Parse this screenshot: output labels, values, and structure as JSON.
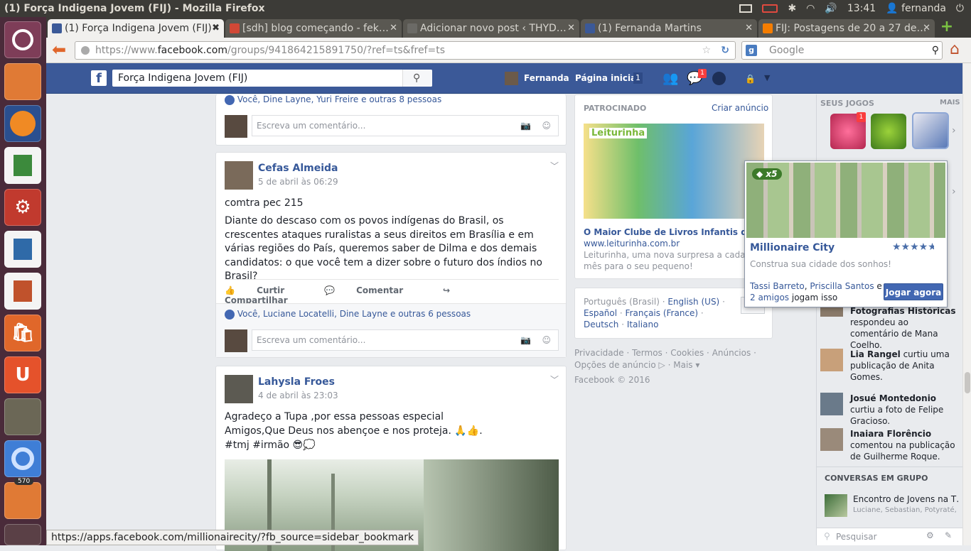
{
  "window": {
    "title": "(1) Força Indigena Jovem (FIJ) - Mozilla Firefox",
    "time": "13:41",
    "user": "fernanda"
  },
  "launcher": {
    "badge": "570",
    "apps": [
      "ubuntu-logo-icon",
      "files-icon",
      "firefox-icon",
      "spreadsheet-icon",
      "settings-icon",
      "writer-icon",
      "impress-icon",
      "shopping-icon",
      "ubuntu-one-icon",
      "gimp-icon",
      "chromium-icon",
      "update-manager-icon",
      "trash-icon"
    ]
  },
  "tabs": [
    {
      "label": "(1) Força Indigena Jovem (FIJ)",
      "icon": "facebook-icon",
      "color": "#3b5998"
    },
    {
      "label": "[sdh] blog começando - fek…",
      "icon": "gmail-icon",
      "color": "#d14836"
    },
    {
      "label": "Adicionar novo post ‹ THYD…",
      "icon": "blank-page-icon",
      "color": "#6b6a66"
    },
    {
      "label": "(1) Fernanda Martins",
      "icon": "facebook-icon",
      "color": "#3b5998"
    },
    {
      "label": "FIJ: Postagens de 20 a 27 de…",
      "icon": "blogger-icon",
      "color": "#f57d00"
    }
  ],
  "nav": {
    "url_prefix": "https://www.",
    "url_domain": "facebook.com",
    "url_rest": "/groups/941864215891750/?ref=ts&fref=ts",
    "search_placeholder": "Google"
  },
  "fb": {
    "search_value": "Força Indigena Jovem (FIJ)",
    "user": "Fernanda",
    "home": "Página inicial",
    "home_count": "1",
    "notif_count": "1"
  },
  "feed": {
    "top_likes": "Você, Dine Layne, Yuri Freire e outras 8 pessoas",
    "comment_placeholder": "Escreva um comentário...",
    "post1": {
      "author": "Cefas Almeida",
      "time": "5 de abril às 06:29",
      "line1": "comtra pec 215",
      "body": "Diante do descaso com os povos indígenas do Brasil, os crescentes ataques ruralistas a seus direitos em Brasília e em várias regiões do País, queremos saber de Dilma e dos demais candidatos: o que você tem a dizer sobre o futuro dos índios no Brasil?",
      "actions": [
        "Curtir",
        "Comentar",
        "Compartilhar"
      ],
      "likes": "Você, Luciane Locatelli, Dine Layne e outras 6 pessoas"
    },
    "post2": {
      "author": "Lahysla Froes",
      "time": "4 de abril às 23:03",
      "line1": "Agradeço a Tupa ,por essa pessoas especial",
      "line2": "Amigos,Que Deus nos abençoe e nos proteja. 🙏👍.",
      "line3": "#tmj #irmão 😎💭"
    }
  },
  "ads": {
    "header": "PATROCINADO",
    "create": "Criar anúncio",
    "brand": "Leiturinha",
    "title": "O Maior Clube de Livros Infantis do Brasil",
    "url": "www.leiturinha.com.br",
    "desc": "Leiturinha, uma nova surpresa a cada mês para o seu pequeno!"
  },
  "languages": {
    "current": "Português (Brasil)",
    "others": [
      "English (US)",
      "Español",
      "Français (France)",
      "Deutsch",
      "Italiano"
    ]
  },
  "footer": {
    "links": [
      "Privacidade",
      "Termos",
      "Cookies",
      "Anúncios",
      "Opções de anúncio",
      "Mais"
    ],
    "copyright": "Facebook © 2016"
  },
  "sidebar": {
    "games_header": "SEUS JOGOS",
    "more": "MAIS",
    "game_badge": "1",
    "activities": [
      {
        "bold": "Fotografias Históricas",
        "text": " respondeu ao comentário de Mana Coelho."
      },
      {
        "bold": "Lia Rangel",
        "text": " curtiu uma publicação de Anita Gomes."
      },
      {
        "bold": "Josué Montedonio",
        "text": " curtiu a foto de Felipe Gracioso."
      },
      {
        "bold": "Inaiara Florêncio",
        "text": " comentou na publicação de Guilherme Roque."
      }
    ],
    "groups_header": "CONVERSAS EM GRUPO",
    "group_name": "Encontro de Jovens na T…",
    "group_members": "Luciane, Sebastian, Potyraté, …",
    "search_placeholder": "Pesquisar"
  },
  "popup": {
    "multiplier": "x5",
    "game": "Millionaire City",
    "rating": 4.5,
    "tagline": "Construa sua cidade dos sonhos!",
    "friend1": "Tassi Barreto",
    "friend2": "Priscilla Santos",
    "and": " e ",
    "friends_more": "2 amigos",
    "play_text": " jogam isso",
    "play_button": "Jogar agora"
  },
  "status_url": "https://apps.facebook.com/millionairecity/?fb_source=sidebar_bookmark"
}
